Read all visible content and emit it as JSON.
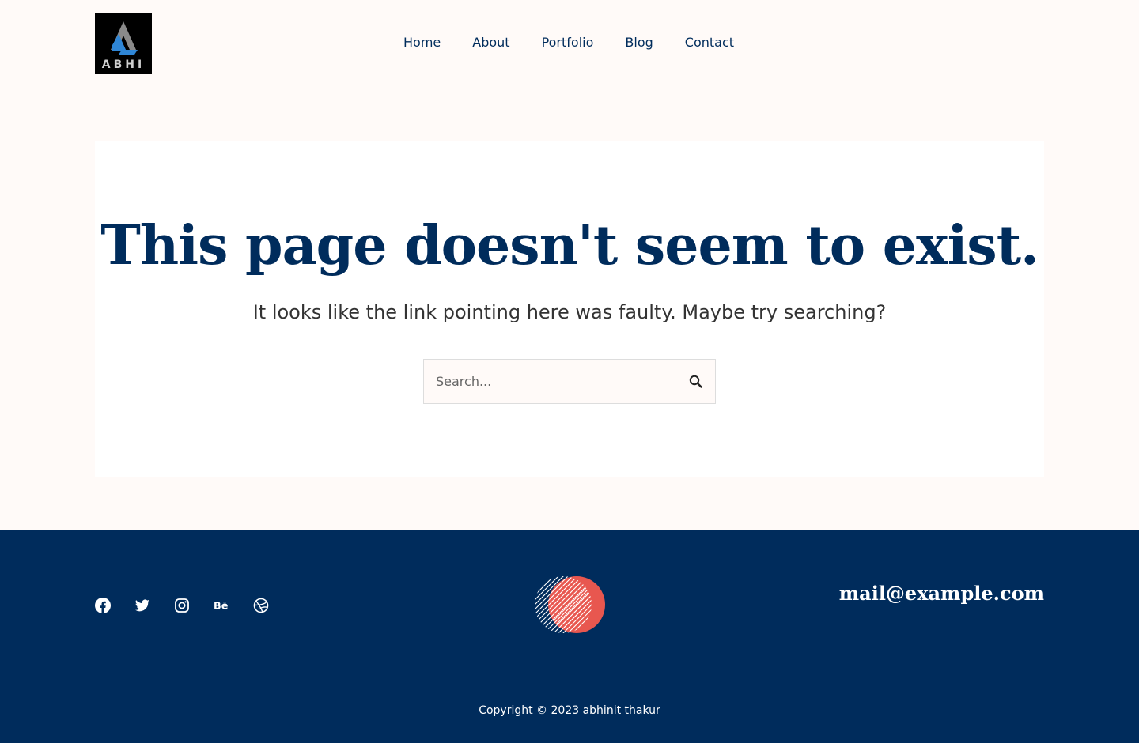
{
  "header": {
    "logo_text": "ABHI",
    "nav": [
      "Home",
      "About",
      "Portfolio",
      "Blog",
      "Contact"
    ]
  },
  "main": {
    "title": "This page doesn't seem to exist.",
    "subtitle": "It looks like the link pointing here was faulty. Maybe try searching?",
    "search_placeholder": "Search..."
  },
  "footer": {
    "socials": [
      "facebook-icon",
      "twitter-icon",
      "instagram-icon",
      "behance-icon",
      "dribbble-icon"
    ],
    "email": "mail@example.com",
    "copyright": "Copyright © 2023 abhinit thakur"
  },
  "colors": {
    "brand": "#002c5c",
    "background": "#fffaf8",
    "accent": "#e8574f"
  }
}
